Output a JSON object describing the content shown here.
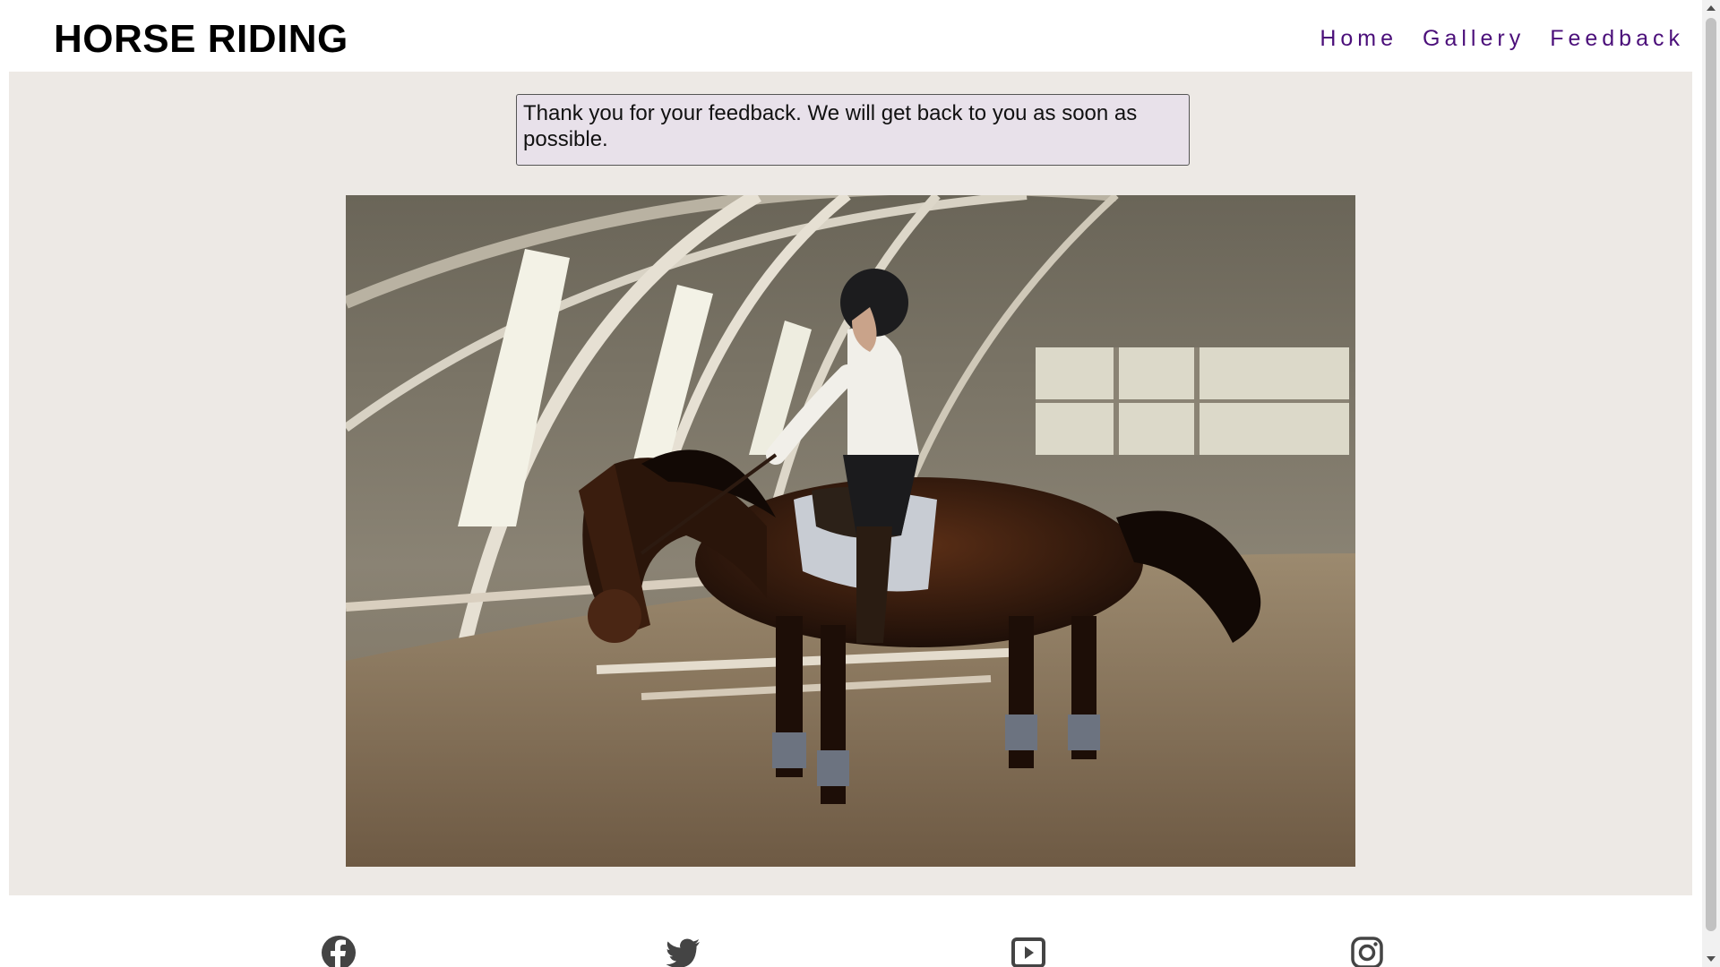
{
  "header": {
    "logo": "HORSE RIDING",
    "nav": [
      {
        "label": "Home"
      },
      {
        "label": "Gallery"
      },
      {
        "label": "Feedback"
      }
    ]
  },
  "main": {
    "feedback_message": "Thank you for your feedback. We will get back to you as soon as possible.",
    "hero_image_icon": "horse-rider-photo"
  },
  "footer": {
    "social_icons": [
      "facebook-icon",
      "twitter-icon",
      "youtube-icon",
      "instagram-icon"
    ]
  },
  "colors": {
    "nav_link": "#4b0f7a",
    "main_bg": "#ede9e5",
    "feedback_bg": "#e8e1ea",
    "icon": "#444444"
  }
}
